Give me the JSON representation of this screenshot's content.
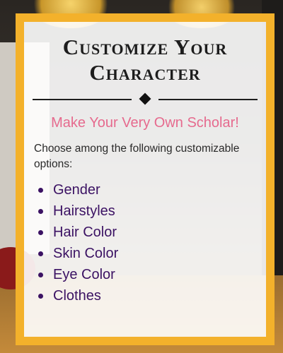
{
  "card": {
    "title_line1": "Customize Your",
    "title_line2": "Character",
    "subtitle": "Make Your Very Own Scholar!",
    "intro": "Choose among the following customizable options:",
    "options": [
      {
        "label": "Gender"
      },
      {
        "label": "Hairstyles"
      },
      {
        "label": "Hair Color"
      },
      {
        "label": "Skin Color"
      },
      {
        "label": "Eye Color"
      },
      {
        "label": "Clothes"
      }
    ]
  },
  "colors": {
    "frame": "#f3b12b",
    "subtitle": "#e66a8e",
    "list_text": "#3b1263"
  }
}
